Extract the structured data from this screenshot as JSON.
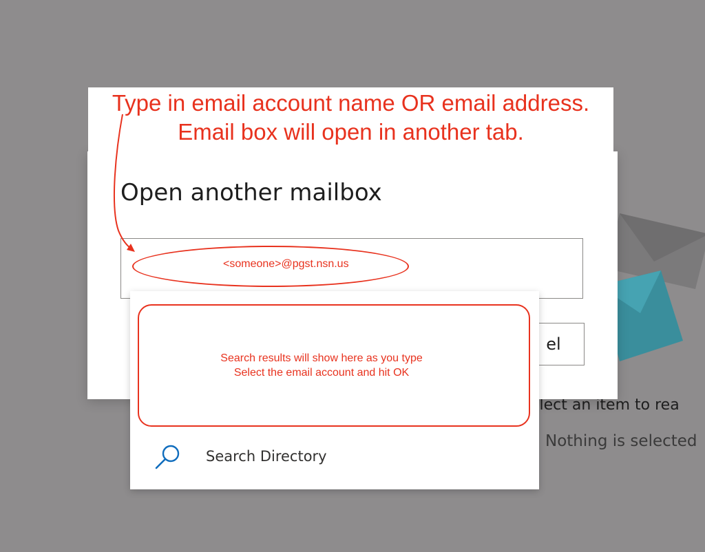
{
  "annotation": {
    "line1": "Type in email account name OR email address.",
    "line2": "Email box will open in another tab.",
    "color": "#e8321e"
  },
  "dialog": {
    "title": "Open another mailbox",
    "input_value": "<someone>@pgst.nsn.us",
    "cancel_label_visible": "el"
  },
  "dropdown": {
    "results_hint_line1": "Search results will show here as you type",
    "results_hint_line2": "Select the email account and hit OK",
    "search_directory_label": "Search Directory",
    "icon": "search-icon"
  },
  "reading_pane": {
    "title_visible": "elect an item to rea",
    "subtitle_visible": "Nothing is selected"
  },
  "colors": {
    "overlay": "#8e8c8d",
    "accent_blue": "#0f6cbd",
    "teal": "#3a97a8"
  }
}
